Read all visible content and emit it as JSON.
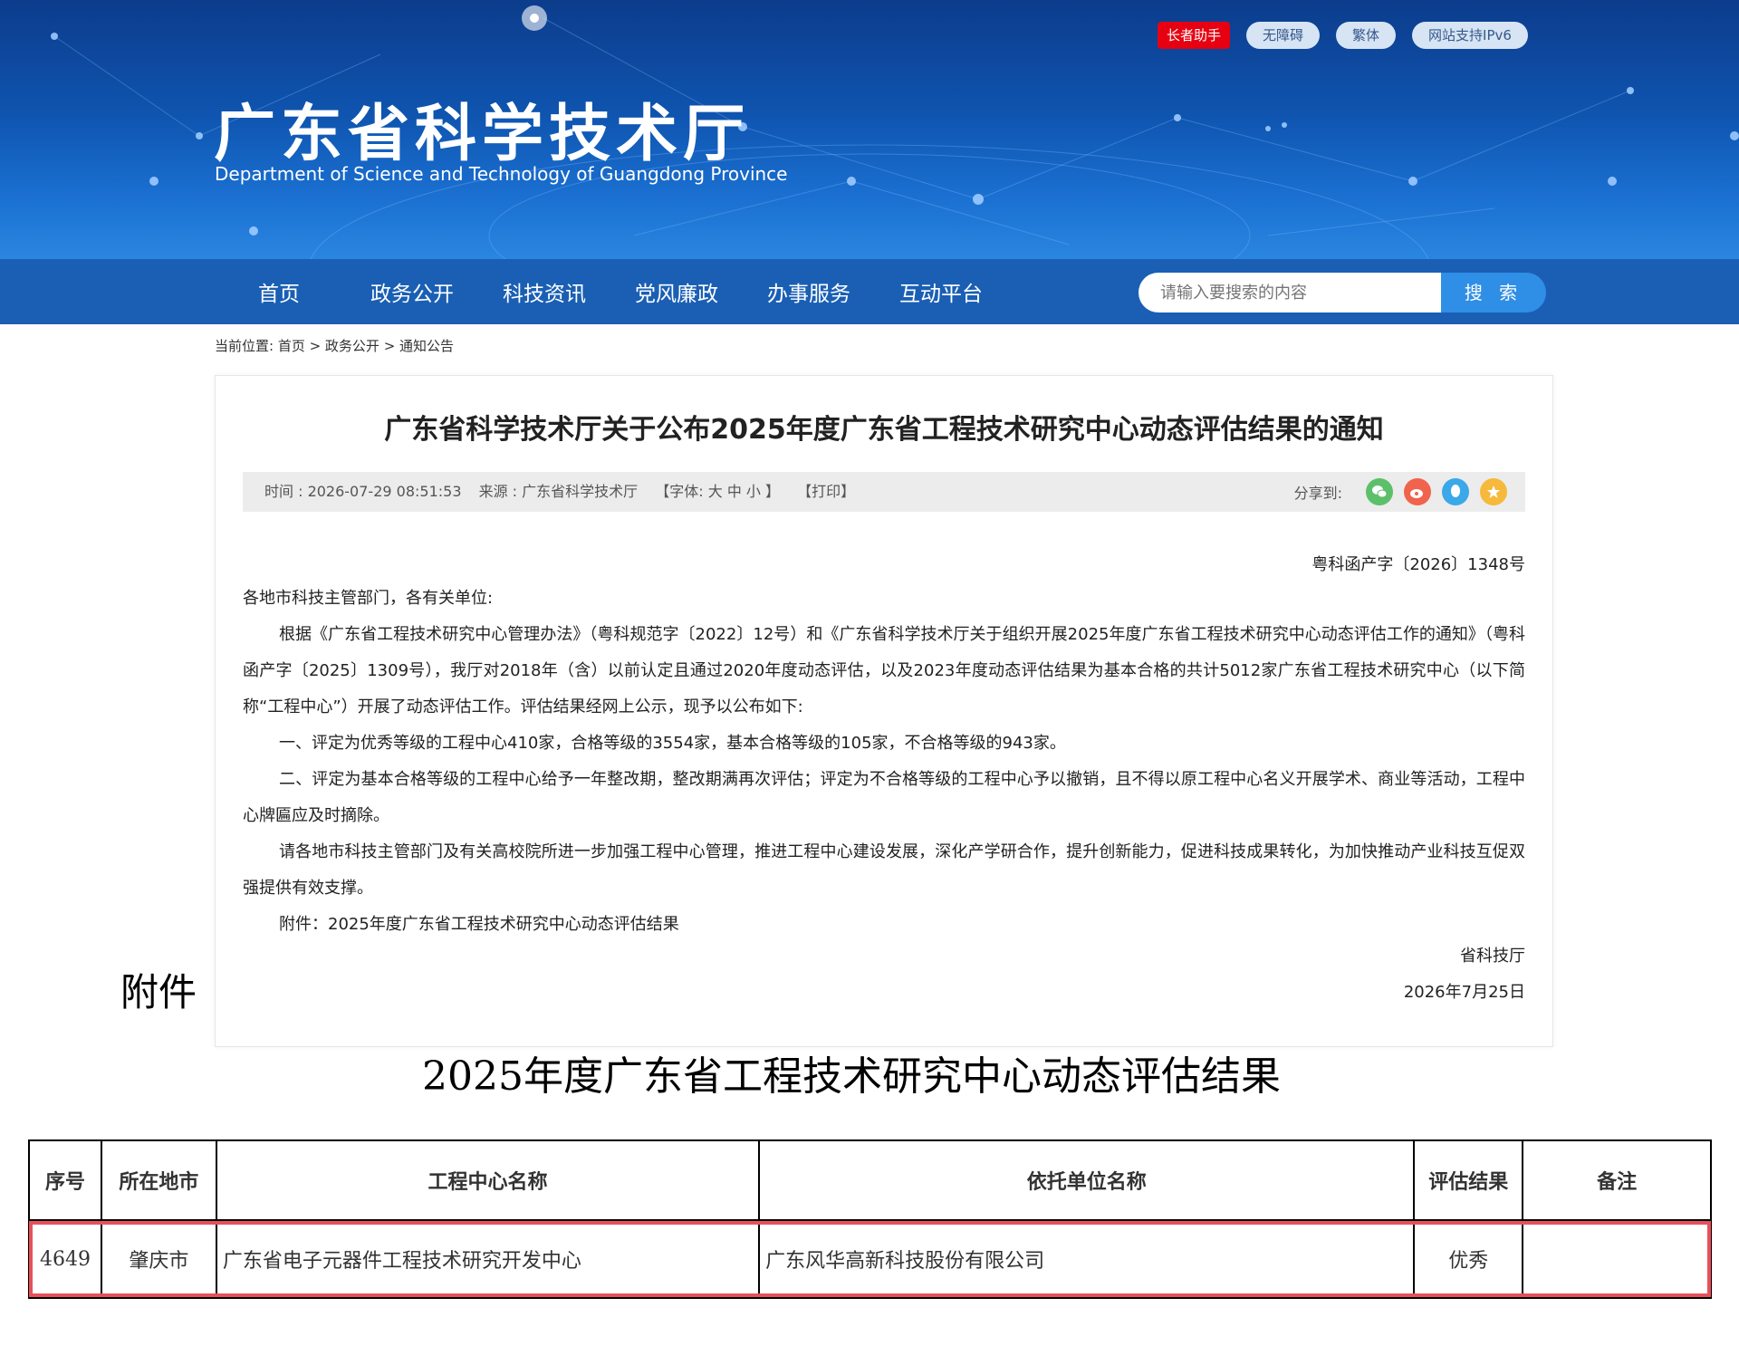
{
  "header": {
    "title": "广东省科学技术厅",
    "subtitle": "Department of Science and Technology of Guangdong Province",
    "top_buttons": [
      "长者助手",
      "无障碍",
      "繁体",
      "网站支持IPv6"
    ],
    "colors": {
      "banner": "#0f55b0",
      "nav": "#1a5fb4",
      "search_button": "#2f8ee6",
      "highlight": "#e8505b",
      "elder_button": "#e60012"
    }
  },
  "nav": {
    "items": [
      "首页",
      "政务公开",
      "科技资讯",
      "党风廉政",
      "办事服务",
      "互动平台"
    ],
    "search_placeholder": "请输入要搜索的内容",
    "search_button": "搜 索"
  },
  "breadcrumb": "当前位置:  首页  >  政务公开  >  通知公告",
  "article": {
    "title": "广东省科学技术厅关于公布2025年度广东省工程技术研究中心动态评估结果的通知",
    "meta": {
      "time": "时间 : 2026-07-29 08:51:53",
      "source": "来源 : 广东省科学技术厅",
      "font_size": "【字体: 大    中    小 】",
      "print": "【打印】",
      "share_label": "分享到:",
      "share_icons": [
        "wechat-icon",
        "weibo-icon",
        "qq-icon",
        "favorite-icon"
      ]
    },
    "doc_number": "粤科函产字〔2026〕1348号",
    "salutation": "各地市科技主管部门，各有关单位:",
    "paragraphs": [
      "根据《广东省工程技术研究中心管理办法》（粤科规范字〔2022〕12号）和《广东省科学技术厅关于组织开展2025年度广东省工程技术研究中心动态评估工作的通知》（粤科函产字〔2025〕1309号），我厅对2018年（含）以前认定且通过2020年度动态评估，以及2023年度动态评估结果为基本合格的共计5012家广东省工程技术研究中心（以下简称“工程中心”）开展了动态评估工作。评估结果经网上公示，现予以公布如下:",
      "一、评定为优秀等级的工程中心410家，合格等级的3554家，基本合格等级的105家，不合格等级的943家。",
      "二、评定为基本合格等级的工程中心给予一年整改期，整改期满再次评估；评定为不合格等级的工程中心予以撤销，且不得以原工程中心名义开展学术、商业等活动，工程中心牌匾应及时摘除。",
      "请各地市科技主管部门及有关高校院所进一步加强工程中心管理，推进工程中心建设发展，深化产学研合作，提升创新能力，促进科技成果转化，为加快推动产业科技互促双强提供有效支撑。",
      "附件：2025年度广东省工程技术研究中心动态评估结果"
    ],
    "signature": "省科技厅",
    "date": "2026年7月25日"
  },
  "attachment": {
    "label": "附件",
    "title": "2025年度广东省工程技术研究中心动态评估结果",
    "columns": [
      "序号",
      "所在地市",
      "工程中心名称",
      "依托单位名称",
      "评估结果",
      "备注"
    ],
    "rows": [
      [
        "4649",
        "肇庆市",
        "广东省电子元器件工程技术研究开发中心",
        "广东风华高新科技股份有限公司",
        "优秀",
        ""
      ]
    ]
  }
}
